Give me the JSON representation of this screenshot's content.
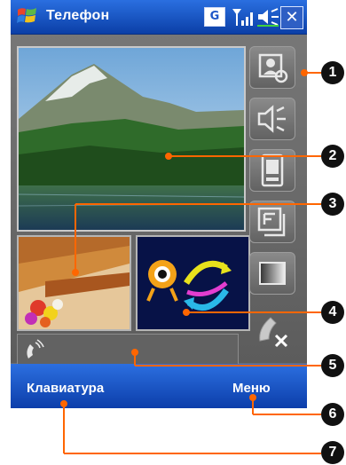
{
  "titlebar": {
    "title": "Телефон",
    "network_badge": "G"
  },
  "softkeys": {
    "left_label": "Клавиатура",
    "right_label": "Меню"
  },
  "callouts": [
    "1",
    "2",
    "3",
    "4",
    "5",
    "6",
    "7"
  ],
  "icons": {
    "start": "windows-flag-icon",
    "signal": "signal-strength-icon",
    "volume": "speaker-volume-icon",
    "close": "close-icon",
    "side_buttons": [
      "camera-switch-icon",
      "speakerphone-icon",
      "device-handset-icon",
      "frame-layout-icon",
      "video-quality-icon",
      "end-call-icon"
    ],
    "dial": "phone-handset-icon"
  },
  "colors": {
    "title_bar": "#1c58c9",
    "callout_line": "#ff6600",
    "callout_badge": "#111111"
  }
}
